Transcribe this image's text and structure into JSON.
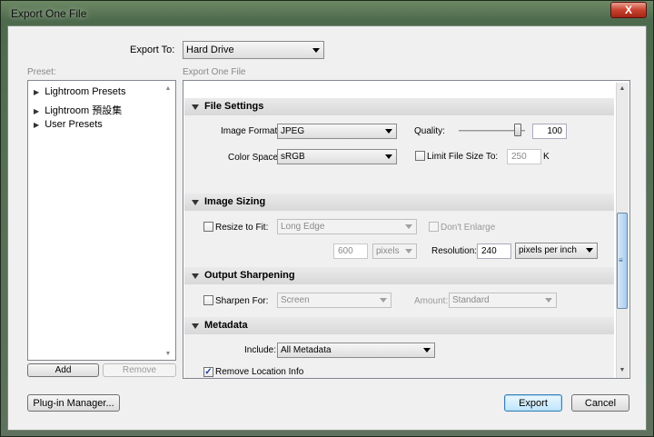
{
  "window": {
    "title": "Export One File",
    "close_glyph": "X"
  },
  "export_to": {
    "label": "Export To:",
    "value": "Hard Drive"
  },
  "preset": {
    "label": "Preset:",
    "items": [
      "Lightroom Presets",
      "Lightroom 預設集",
      "User Presets"
    ],
    "add_label": "Add",
    "remove_label": "Remove"
  },
  "panel_label": "Export One File",
  "file_settings": {
    "header": "File Settings",
    "image_format_label": "Image Format:",
    "image_format_value": "JPEG",
    "quality_label": "Quality:",
    "quality_value": "100",
    "color_space_label": "Color Space:",
    "color_space_value": "sRGB",
    "limit_label": "Limit File Size To:",
    "limit_value": "250",
    "limit_unit": "K"
  },
  "image_sizing": {
    "header": "Image Sizing",
    "resize_label": "Resize to Fit:",
    "resize_value": "Long Edge",
    "dont_enlarge_label": "Don't Enlarge",
    "size_value": "600",
    "size_unit": "pixels",
    "resolution_label": "Resolution:",
    "resolution_value": "240",
    "resolution_unit": "pixels per inch"
  },
  "output_sharpening": {
    "header": "Output Sharpening",
    "sharpen_label": "Sharpen For:",
    "sharpen_value": "Screen",
    "amount_label": "Amount:",
    "amount_value": "Standard"
  },
  "metadata": {
    "header": "Metadata",
    "include_label": "Include:",
    "include_value": "All Metadata",
    "remove_location_label": "Remove Location Info",
    "remove_location_checked": true
  },
  "buttons": {
    "plugin_manager": "Plug-in Manager...",
    "export": "Export",
    "cancel": "Cancel"
  },
  "colors": {
    "primary_button": "#bee6fd",
    "section_header": "#d8d8d8",
    "close_button": "#c8412e"
  }
}
